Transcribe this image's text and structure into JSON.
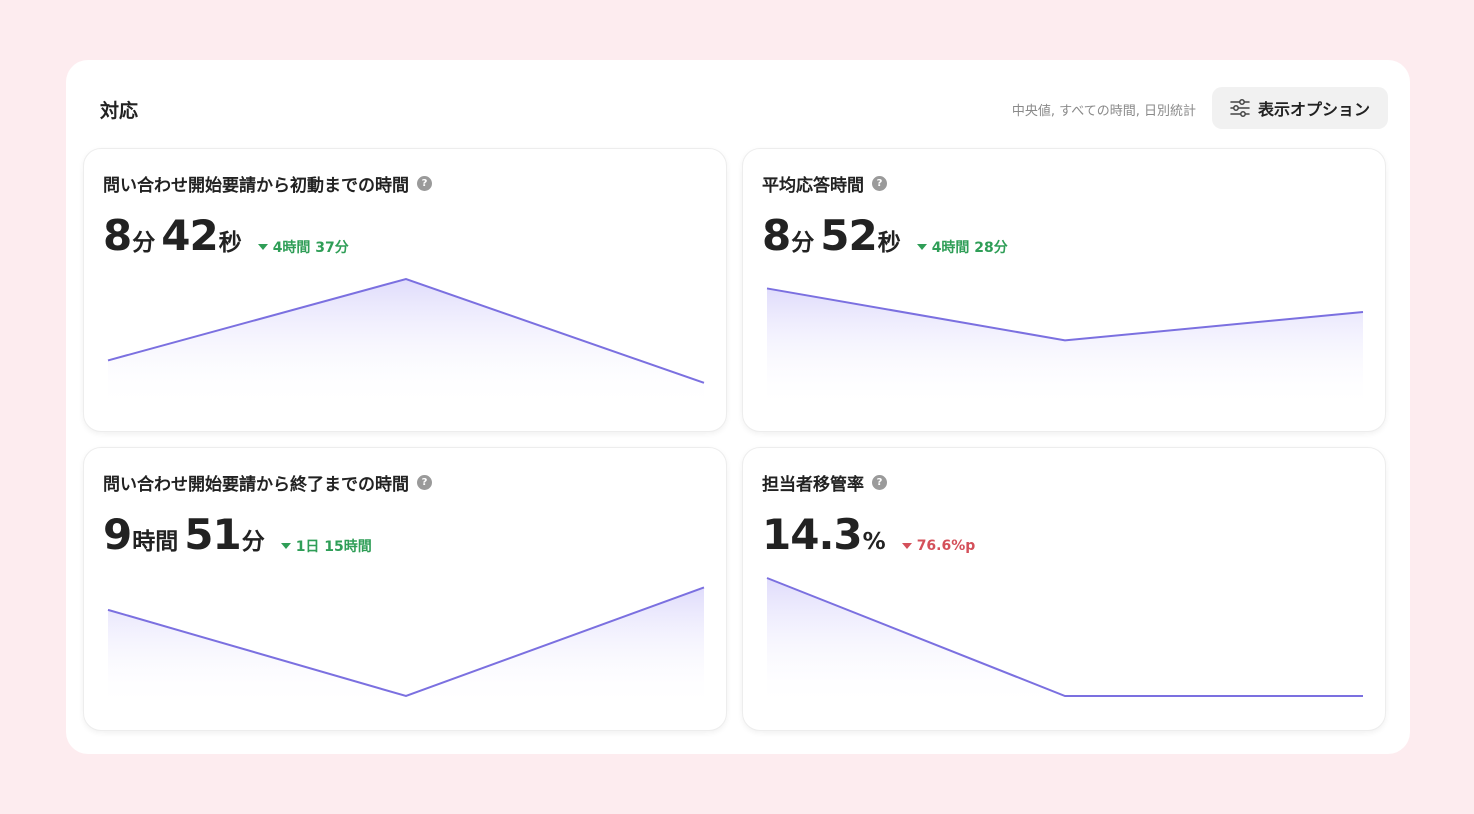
{
  "panel": {
    "title": "対応",
    "meta": "中央値, すべての時間, 日別統計",
    "options_label": "表示オプション"
  },
  "colors": {
    "line": "#7b70e0",
    "fill_top": "#dcd8fb",
    "positive": "#2f9e57",
    "negative": "#d4505a"
  },
  "cards": [
    {
      "title": "問い合わせ開始要請から初動までの時間",
      "parts": [
        {
          "num": "8",
          "unit": "分"
        },
        {
          "num": "42",
          "unit": "秒"
        }
      ],
      "delta": "4時間 37分",
      "trend": "green"
    },
    {
      "title": "平均応答時間",
      "parts": [
        {
          "num": "8",
          "unit": "分"
        },
        {
          "num": "52",
          "unit": "秒"
        }
      ],
      "delta": "4時間 28分",
      "trend": "green"
    },
    {
      "title": "問い合わせ開始要請から終了までの時間",
      "parts": [
        {
          "num": "9",
          "unit": "時間"
        },
        {
          "num": "51",
          "unit": "分"
        }
      ],
      "delta": "1日 15時間",
      "trend": "green"
    },
    {
      "title": "担当者移管率",
      "parts": [
        {
          "num": "14.3",
          "unit": "%"
        }
      ],
      "delta": "76.6%p",
      "trend": "red"
    }
  ],
  "chart_data": [
    {
      "type": "area",
      "x": [
        1,
        2,
        3
      ],
      "values": [
        0.31,
        1.0,
        0.12
      ]
    },
    {
      "type": "area",
      "x": [
        1,
        2,
        3
      ],
      "values": [
        0.92,
        0.48,
        0.72
      ]
    },
    {
      "type": "area",
      "x": [
        1,
        2,
        3
      ],
      "values": [
        0.73,
        0.0,
        0.92
      ]
    },
    {
      "type": "area",
      "x": [
        1,
        2,
        3
      ],
      "values": [
        1.0,
        0.0,
        0.0
      ]
    }
  ]
}
